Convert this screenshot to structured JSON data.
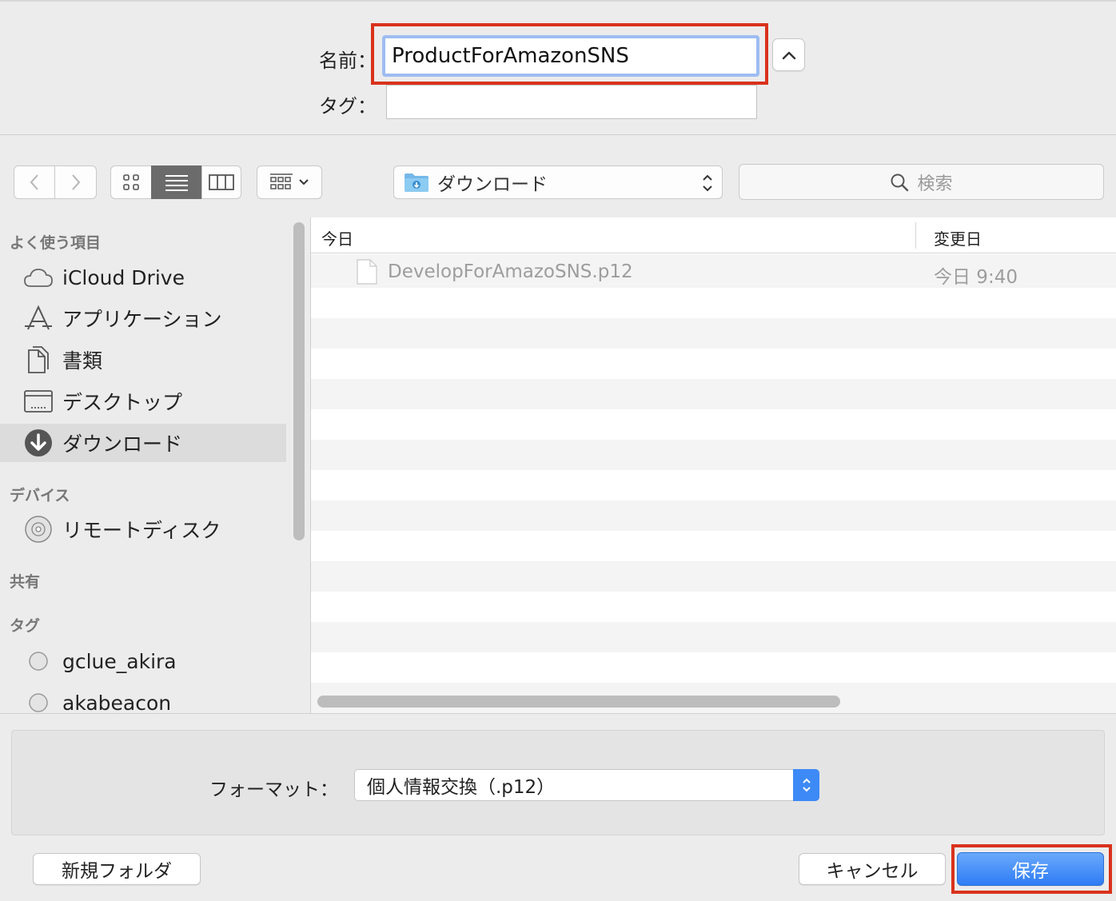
{
  "name_field": {
    "label": "名前：",
    "value": "ProductForAmazonSNS"
  },
  "tag_field": {
    "label": "タグ：",
    "value": ""
  },
  "location": {
    "label": "ダウンロード"
  },
  "search": {
    "placeholder": "検索"
  },
  "sidebar": {
    "favorites_header": "よく使う項目",
    "favorites": [
      {
        "label": "iCloud Drive",
        "icon": "cloud-icon"
      },
      {
        "label": "アプリケーション",
        "icon": "applications-icon"
      },
      {
        "label": "書類",
        "icon": "documents-icon"
      },
      {
        "label": "デスクトップ",
        "icon": "desktop-icon"
      },
      {
        "label": "ダウンロード",
        "icon": "downloads-icon",
        "selected": true
      }
    ],
    "devices_header": "デバイス",
    "devices": [
      {
        "label": "リモートディスク",
        "icon": "disc-icon"
      }
    ],
    "shared_header": "共有",
    "tags_header": "タグ",
    "tags": [
      {
        "label": "gclue_akira",
        "icon": "tag-circle-icon"
      },
      {
        "label": "akabeacon",
        "icon": "tag-circle-icon"
      }
    ]
  },
  "file_list": {
    "columns": [
      "今日",
      "変更日"
    ],
    "files": [
      {
        "name": "DevelopForAmazoSNS.p12",
        "date": "今日 9:40"
      }
    ]
  },
  "format": {
    "label": "フォーマット：",
    "value": "個人情報交換（.p12）"
  },
  "buttons": {
    "new_folder": "新規フォルダ",
    "cancel": "キャンセル",
    "save": "保存"
  },
  "colors": {
    "highlight": "#d9321c",
    "accent": "#2f7cf5",
    "focus_ring": "#9ebcf1"
  }
}
